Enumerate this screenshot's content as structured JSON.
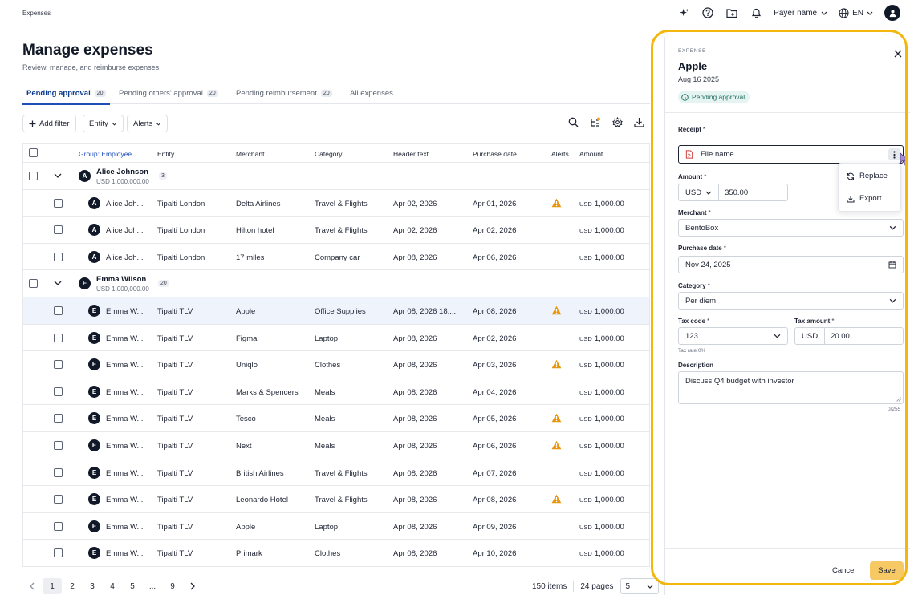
{
  "topbar": {
    "breadcrumb": "Expenses",
    "payer_label": "Payer name",
    "language": "EN",
    "icons": [
      "sparkle-icon",
      "help-icon",
      "folder-icon",
      "bell-icon",
      "globe-icon",
      "user-icon"
    ]
  },
  "header": {
    "title": "Manage expenses",
    "subtitle": "Review, manage, and reimburse expenses."
  },
  "tabs": [
    {
      "label": "Pending approval",
      "count": "20",
      "active": true
    },
    {
      "label": "Pending others' approval",
      "count": "20",
      "active": false
    },
    {
      "label": "Pending reimbursement",
      "count": "20",
      "active": false
    },
    {
      "label": "All expenses",
      "count": "",
      "active": false
    }
  ],
  "filters": {
    "add_filter": "Add filter",
    "entity": "Entity",
    "alerts": "Alerts"
  },
  "table": {
    "columns": [
      "Group: Employee",
      "Entity",
      "Merchant",
      "Category",
      "Header text",
      "Purchase date",
      "Alerts",
      "Amount"
    ],
    "groups": [
      {
        "initial": "A",
        "name": "Alice Johnson",
        "amount": "USD 1,000,000.00",
        "count": "3",
        "rows": [
          {
            "initial": "A",
            "employee": "Alice Joh...",
            "entity": "Tipalti London",
            "merchant": "Delta Airlines",
            "category": "Travel & Flights",
            "header_text": "Apr 02, 2026",
            "purchase_date": "Apr 01, 2026",
            "alert": true,
            "currency": "USD",
            "amount": "1,000.00"
          },
          {
            "initial": "A",
            "employee": "Alice Joh...",
            "entity": "Tipalti London",
            "merchant": "Hilton hotel",
            "category": "Travel & Flights",
            "header_text": "Apr 02, 2026",
            "purchase_date": "Apr 02, 2026",
            "alert": false,
            "currency": "USD",
            "amount": "1,000.00"
          },
          {
            "initial": "A",
            "employee": "Alice Joh...",
            "entity": "Tipalti London",
            "merchant": "17 miles",
            "category": "Company car",
            "header_text": "Apr 08, 2026",
            "purchase_date": "Apr 06, 2026",
            "alert": false,
            "currency": "USD",
            "amount": "1,000.00"
          }
        ]
      },
      {
        "initial": "E",
        "name": "Emma Wilson",
        "amount": "USD 1,000,000.00",
        "count": "20",
        "rows": [
          {
            "initial": "E",
            "employee": "Emma W...",
            "entity": "Tipalti TLV",
            "merchant": "Apple",
            "category": "Office Supplies",
            "header_text": "Apr 08, 2026 18:...",
            "purchase_date": "Apr 08, 2026",
            "alert": true,
            "currency": "USD",
            "amount": "1,000.00",
            "selected": true
          },
          {
            "initial": "E",
            "employee": "Emma W...",
            "entity": "Tipalti TLV",
            "merchant": "Figma",
            "category": "Laptop",
            "header_text": "Apr 08, 2026",
            "purchase_date": "Apr 02, 2026",
            "alert": false,
            "currency": "USD",
            "amount": "1,000.00"
          },
          {
            "initial": "E",
            "employee": "Emma W...",
            "entity": "Tipalti TLV",
            "merchant": "Uniqlo",
            "category": "Clothes",
            "header_text": "Apr 08, 2026",
            "purchase_date": "Apr 03, 2026",
            "alert": true,
            "currency": "USD",
            "amount": "1,000.00"
          },
          {
            "initial": "E",
            "employee": "Emma W...",
            "entity": "Tipalti TLV",
            "merchant": "Marks & Spencers",
            "category": "Meals",
            "header_text": "Apr 08, 2026",
            "purchase_date": "Apr 04, 2026",
            "alert": false,
            "currency": "USD",
            "amount": "1,000.00"
          },
          {
            "initial": "E",
            "employee": "Emma W...",
            "entity": "Tipalti TLV",
            "merchant": "Tesco",
            "category": "Meals",
            "header_text": "Apr 08, 2026",
            "purchase_date": "Apr 05, 2026",
            "alert": true,
            "currency": "USD",
            "amount": "1,000.00"
          },
          {
            "initial": "E",
            "employee": "Emma W...",
            "entity": "Tipalti TLV",
            "merchant": "Next",
            "category": "Meals",
            "header_text": "Apr 08, 2026",
            "purchase_date": "Apr 06, 2026",
            "alert": true,
            "currency": "USD",
            "amount": "1,000.00"
          },
          {
            "initial": "E",
            "employee": "Emma W...",
            "entity": "Tipalti TLV",
            "merchant": "British Airlines",
            "category": "Travel & Flights",
            "header_text": "Apr 08, 2026",
            "purchase_date": "Apr 07, 2026",
            "alert": false,
            "currency": "USD",
            "amount": "1,000.00"
          },
          {
            "initial": "E",
            "employee": "Emma W...",
            "entity": "Tipalti TLV",
            "merchant": "Leonardo Hotel",
            "category": "Travel & Flights",
            "header_text": "Apr 08, 2026",
            "purchase_date": "Apr 08, 2026",
            "alert": true,
            "currency": "USD",
            "amount": "1,000.00"
          },
          {
            "initial": "E",
            "employee": "Emma W...",
            "entity": "Tipalti TLV",
            "merchant": "Apple",
            "category": "Laptop",
            "header_text": "Apr 08, 2026",
            "purchase_date": "Apr 09, 2026",
            "alert": false,
            "currency": "USD",
            "amount": "1,000.00"
          },
          {
            "initial": "E",
            "employee": "Emma W...",
            "entity": "Tipalti TLV",
            "merchant": "Primark",
            "category": "Clothes",
            "header_text": "Apr 08, 2026",
            "purchase_date": "Apr 10, 2026",
            "alert": false,
            "currency": "USD",
            "amount": "1,000.00"
          }
        ]
      }
    ]
  },
  "pagination": {
    "pages": [
      "1",
      "2",
      "3",
      "4",
      "5",
      "...",
      "9"
    ],
    "current": "1",
    "items": "150 items",
    "total_pages": "24 pages",
    "per_page": "5"
  },
  "panel": {
    "kicker": "EXPENSE",
    "title": "Apple",
    "date": "Aug 16 2025",
    "status": "Pending approval",
    "receipt_label": "Receipt",
    "file_name": "File name",
    "menu": {
      "replace": "Replace",
      "export": "Export"
    },
    "amount_label": "Amount",
    "currency": "USD",
    "amount": "350.00",
    "merchant_label": "Merchant",
    "merchant": "BentoBox",
    "purchase_date_label": "Purchase date",
    "purchase_date": "Nov 24, 2025",
    "category_label": "Category",
    "category": "Per diem",
    "tax_code_label": "Tax code",
    "tax_code": "123",
    "tax_rate_hint": "Tax rate 0%",
    "tax_amount_label": "Tax amount",
    "tax_currency": "USD",
    "tax_amount": "20.00",
    "description_label": "Description",
    "description": "Discuss Q4 budget with investor",
    "char_count": "0/255",
    "required_mark": "*",
    "cancel": "Cancel",
    "save": "Save"
  },
  "colors": {
    "accent": "#1e4fb8",
    "highlight": "#f2b60d",
    "save": "#f6c964",
    "alert": "#e8940c",
    "status_bg": "#e6f4f1"
  }
}
